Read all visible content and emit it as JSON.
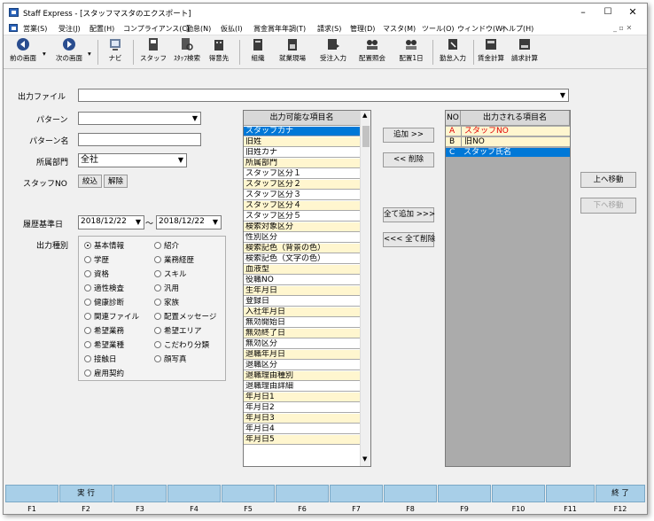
{
  "window": {
    "title": "Staff Express - [スタッフマスタのエクスポート]"
  },
  "menu": [
    "営業(S)",
    "受注(J)",
    "配置(H)",
    "コンプライアンス(C)",
    "勤怠(N)",
    "仮払(I)",
    "賞金賞年年調(T)",
    "請求(S)",
    "管理(D)",
    "マスタ(M)",
    "ツール(O)",
    "ウィンドウ(W)",
    "ヘルプ(H)"
  ],
  "toolbar": {
    "prev": "前の画面",
    "next": "次の画面",
    "nav": "ナビ",
    "staff": "スタッフ",
    "staff_search": "ｽﾀｯﾌ検索",
    "client": "得意先",
    "org": "組織",
    "site": "就業現場",
    "order_input": "受注入力",
    "assign_view": "配置照会",
    "assign_day": "配置1日",
    "attendance": "勤怠入力",
    "pay_calc": "賃金計算",
    "bill_calc": "請求計算"
  },
  "form": {
    "output_file_label": "出力ファイル",
    "output_file_value": "",
    "pattern_label": "パターン",
    "pattern_value": "",
    "pattern_name_label": "パターン名",
    "pattern_name_value": "",
    "dept_label": "所属部門",
    "dept_value": "全社",
    "staff_no_label": "スタッフNO",
    "narrow_btn": "絞込",
    "clear_btn": "解除",
    "date_label": "履歴基準日",
    "date_from": "2018/12/22",
    "date_to": "2018/12/22",
    "tilde": "～",
    "type_label": "出力種別"
  },
  "radios": {
    "col1": [
      "基本情報",
      "学歴",
      "資格",
      "適性検査",
      "健康診断",
      "関連ファイル",
      "希望業務",
      "希望業種",
      "接触日",
      "雇用契約"
    ],
    "col2": [
      "紹介",
      "業務経歴",
      "スキル",
      "汎用",
      "家族",
      "配置メッセージ",
      "希望エリア",
      "こだわり分類",
      "顔写真"
    ],
    "selected": "基本情報"
  },
  "available": {
    "header": "出力可能な項目名",
    "items": [
      "スタッフカナ",
      "旧姓",
      "旧姓カナ",
      "所属部門",
      "スタッフ区分１",
      "スタッフ区分２",
      "スタッフ区分３",
      "スタッフ区分４",
      "スタッフ区分５",
      "検索対象区分",
      "性別区分",
      "検索記色（背景の色）",
      "検索記色（文字の色）",
      "血液型",
      "役職NO",
      "生年月日",
      "登録日",
      "入社年月日",
      "無効開始日",
      "無効終了日",
      "無効区分",
      "退職年月日",
      "退職区分",
      "退職理由種別",
      "退職理由詳細",
      "年月日1",
      "年月日2",
      "年月日3",
      "年月日4",
      "年月日5"
    ],
    "selected": "スタッフカナ"
  },
  "center_buttons": {
    "add": "追加 >>",
    "remove": "<< 削除",
    "add_all": "全て追加 >>>",
    "remove_all": "<<< 全て削除"
  },
  "output": {
    "header_no": "NO",
    "header_name": "出力される項目名",
    "rows": [
      {
        "no": "A",
        "name": "スタッフNO"
      },
      {
        "no": "B",
        "name": "旧NO"
      },
      {
        "no": "C",
        "name": "スタッフ氏名"
      }
    ]
  },
  "side_buttons": {
    "up": "上へ移動",
    "down": "下へ移動"
  },
  "fkeys": [
    {
      "key": "F1",
      "label": ""
    },
    {
      "key": "F2",
      "label": "実 行"
    },
    {
      "key": "F3",
      "label": ""
    },
    {
      "key": "F4",
      "label": ""
    },
    {
      "key": "F5",
      "label": ""
    },
    {
      "key": "F6",
      "label": ""
    },
    {
      "key": "F7",
      "label": ""
    },
    {
      "key": "F8",
      "label": ""
    },
    {
      "key": "F9",
      "label": ""
    },
    {
      "key": "F10",
      "label": ""
    },
    {
      "key": "F11",
      "label": ""
    },
    {
      "key": "F12",
      "label": "終 了"
    }
  ],
  "colors": {
    "selection": "#0078d7",
    "list_alt": "#fff6cf",
    "fkey": "#a8cfe8",
    "red_text": "#e00000"
  }
}
